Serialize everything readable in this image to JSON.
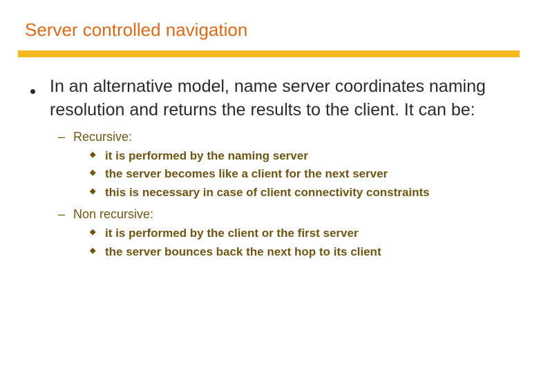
{
  "title": "Server controlled navigation",
  "main_bullet": "In an alternative model, name server coordinates naming resolution and returns the results to the client. It can be:",
  "recursive": {
    "label": "Recursive:",
    "points": [
      "it is performed by the naming server",
      "the server becomes like a client for the next server",
      "this is necessary in case of  client connectivity constraints"
    ]
  },
  "nonrecursive": {
    "label": "Non recursive:",
    "points": [
      "it is performed by the client or the first server",
      "the server bounces back the next hop to its client"
    ]
  }
}
